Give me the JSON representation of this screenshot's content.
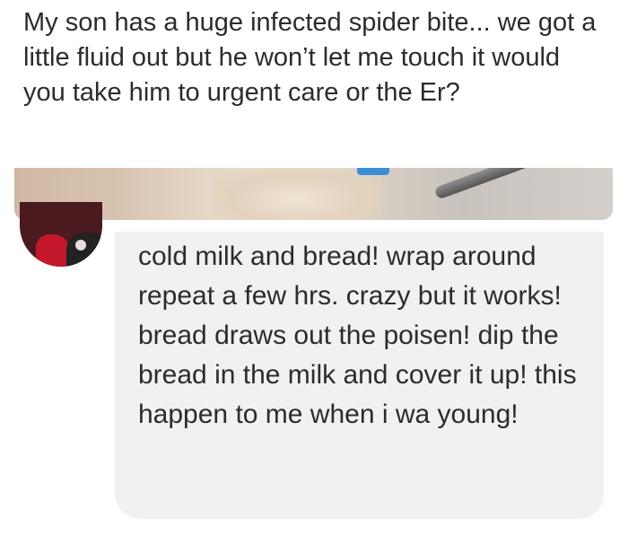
{
  "post": {
    "text": "My son has a huge infected spider bite... we got a little fluid out but he won’t let me touch it would you take him to urgent care or the Er?"
  },
  "comment": {
    "text": "cold milk and bread! wrap around repeat a few hrs. crazy but it works! bread draws out the poisen! dip the bread in the milk and cover it up! this happen to me when i wa young!"
  },
  "colors": {
    "text": "#2c2c2c",
    "bubble_background": "#eff1f3",
    "page_background": "#ffffff"
  }
}
